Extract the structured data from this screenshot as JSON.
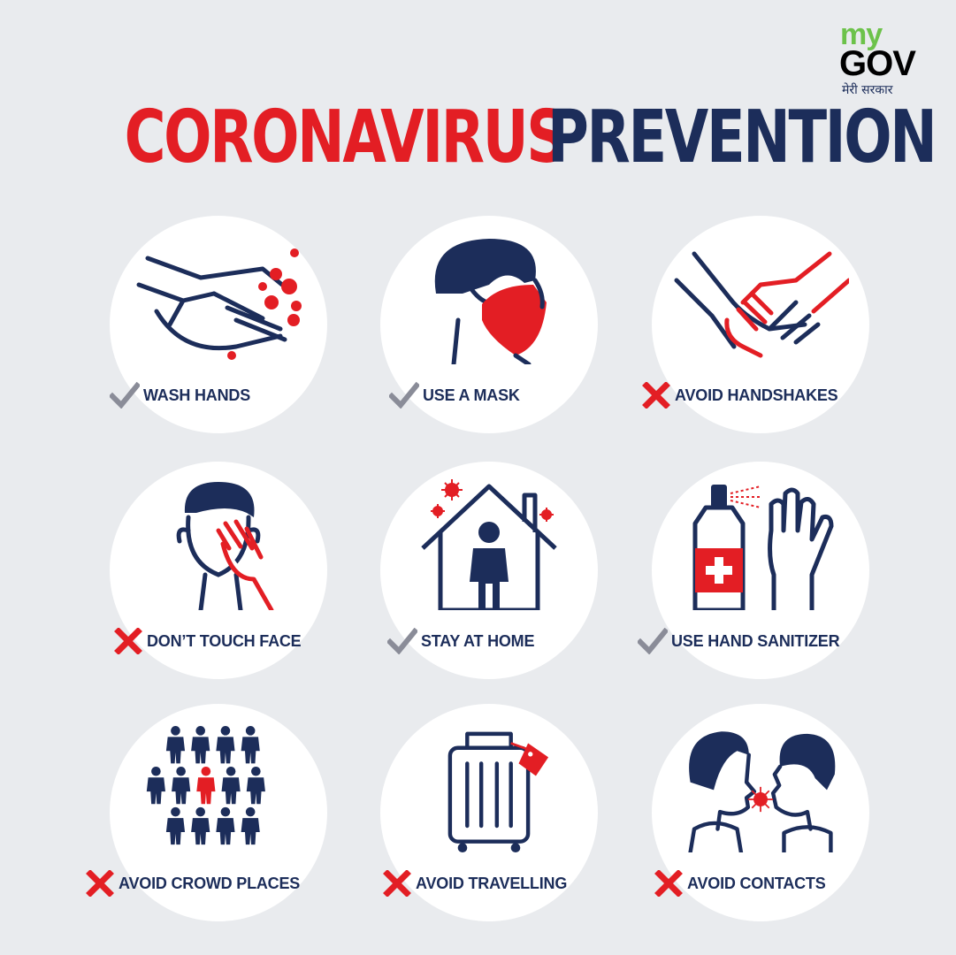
{
  "logo": {
    "my": "my",
    "gov": "GOV",
    "hindi": "मेरी सरकार"
  },
  "title": {
    "part1": "CORONAVIRUS",
    "part2": "PREVENTION"
  },
  "colors": {
    "red": "#e31e24",
    "navy": "#1c2d5a",
    "gray": "#8a8c98",
    "background": "#e9ebee"
  },
  "items": [
    {
      "label": "WASH HANDS",
      "mark": "check",
      "icon": "washing-hands-icon"
    },
    {
      "label": "USE A MASK",
      "mark": "check",
      "icon": "face-mask-icon"
    },
    {
      "label": "AVOID HANDSHAKES",
      "mark": "cross",
      "icon": "handshake-icon"
    },
    {
      "label": "DON’T TOUCH FACE",
      "mark": "cross",
      "icon": "touch-face-icon"
    },
    {
      "label": "STAY AT HOME",
      "mark": "check",
      "icon": "house-icon"
    },
    {
      "label": "USE HAND SANITIZER",
      "mark": "check",
      "icon": "sanitizer-icon"
    },
    {
      "label": "AVOID CROWD PLACES",
      "mark": "cross",
      "icon": "crowd-icon"
    },
    {
      "label": "AVOID TRAVELLING",
      "mark": "cross",
      "icon": "suitcase-icon"
    },
    {
      "label": "AVOID CONTACTS",
      "mark": "cross",
      "icon": "two-faces-icon"
    }
  ]
}
